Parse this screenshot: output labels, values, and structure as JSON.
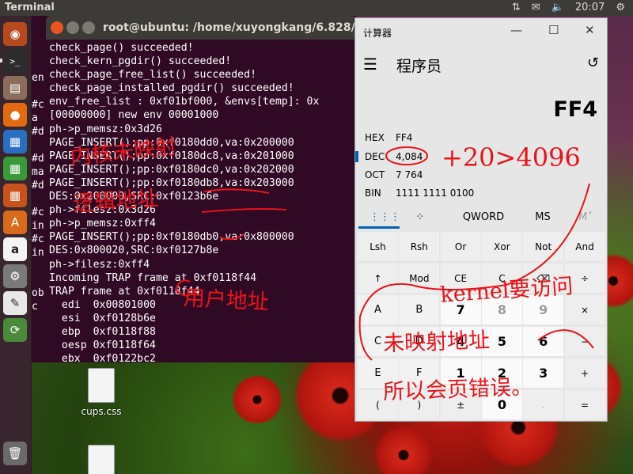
{
  "top_panel": {
    "app_name": "Terminal",
    "clock": "20:07"
  },
  "launcher": {
    "items": [
      "ubuntu-logo",
      "terminal",
      "files",
      "firefox",
      "writer",
      "calc-sheet",
      "impress",
      "software-center",
      "amazon",
      "settings",
      "text-editor",
      "updater"
    ],
    "trash": "trash-icon"
  },
  "terminal": {
    "title": "root@ubuntu: /home/xuyongkang/6.828/la",
    "background": "#300a24",
    "left_fragments": [
      "en",
      "",
      "#c",
      "a",
      "#d",
      "",
      "#d",
      "ma",
      "#d",
      "",
      "#c",
      "in",
      "#c",
      "in",
      "",
      "",
      "ob",
      "c"
    ],
    "lines": [
      "check_page() succeeded!",
      "check_kern_pgdir() succeeded!",
      "check_page_free_list() succeeded!",
      "check_page_installed_pgdir() succeeded!",
      "env_free_list : 0xf01bf000, &envs[temp]: 0x",
      "[00000000] new env 00001000",
      "ph->p_memsz:0x3d26",
      "PAGE_INSERT();pp:0xf0180dd0,va:0x200000",
      "PAGE_INSERT();pp:0xf0180dc8,va:0x201000",
      "PAGE_INSERT();pp:0xf0180dc0,va:0x202000",
      "PAGE_INSERT();pp:0xf0180db8,va:0x203000",
      "DES:0x200000,SRC:0xf0123b6e",
      "ph->filesz:0x3d26",
      "ph->p_memsz:0xff4",
      "PAGE_INSERT();pp:0xf0180db0,va:0x800000",
      "DES:0x800020,SRC:0xf0127b8e",
      "ph->filesz:0xff4",
      "Incoming TRAP frame at 0xf0118f44",
      "TRAP frame at 0xf0118f44",
      "  edi  0x00801000",
      "  esi  0xf0128b6e",
      "  ebp  0xf0118f88",
      "  oesp 0xf0118f64",
      "  ebx  0xf0122bc2"
    ]
  },
  "calculator": {
    "window_title": "计算器",
    "mode": "程序员",
    "display": "FF4",
    "radix": [
      {
        "label": "HEX",
        "value": "FF4"
      },
      {
        "label": "DEC",
        "value": "4,084"
      },
      {
        "label": "OCT",
        "value": "7 764"
      },
      {
        "label": "BIN",
        "value": "1111 1111 0100"
      }
    ],
    "tabs": [
      "⋮⋮⋮",
      "⁘",
      "QWORD",
      "MS",
      "M˅"
    ],
    "keys": [
      [
        "Lsh",
        "Rsh",
        "Or",
        "Xor",
        "Not",
        "And"
      ],
      [
        "↑",
        "Mod",
        "CE",
        "C",
        "⌫",
        "÷"
      ],
      [
        "A",
        "B",
        "7",
        "8",
        "9",
        "×"
      ],
      [
        "C",
        "D",
        "4",
        "5",
        "6",
        "−"
      ],
      [
        "E",
        "F",
        "1",
        "2",
        "3",
        "+"
      ],
      [
        "(",
        ")",
        "±",
        "0",
        ".",
        "="
      ]
    ]
  },
  "desktop_files": [
    {
      "name": "cups.css"
    },
    {
      "name": ""
    }
  ],
  "annotations": {
    "note_1": "内核未映射",
    "note_2": "逻辑地址",
    "note_3": "用户地址",
    "note_4": "+20>4096",
    "note_5": "kernel要访问",
    "note_6": "未映射地址",
    "note_7": "所以会页错误。"
  }
}
